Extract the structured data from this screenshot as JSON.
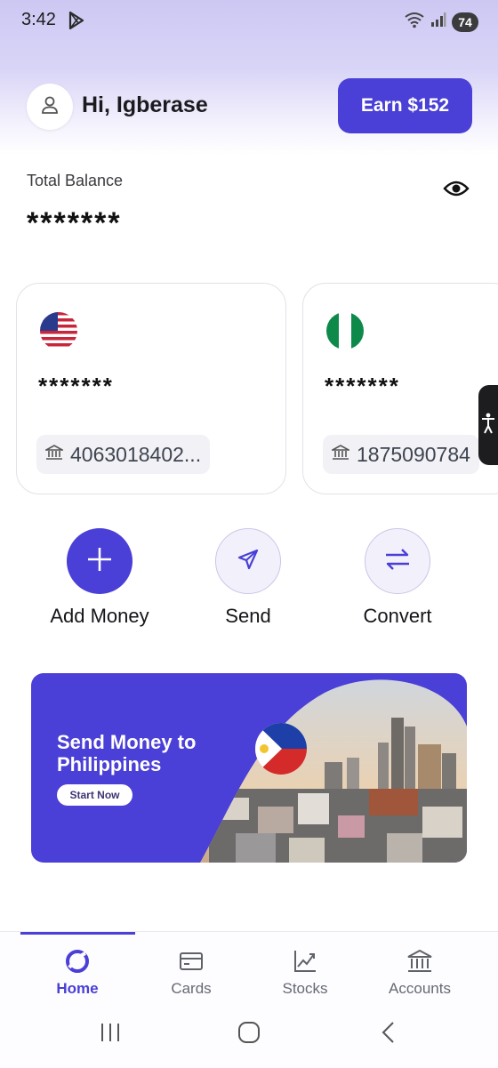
{
  "status_bar": {
    "time": "3:42",
    "battery": "74"
  },
  "header": {
    "greeting": "Hi, Igberase",
    "earn_label": "Earn $152"
  },
  "balance": {
    "label": "Total Balance",
    "value": "*******"
  },
  "wallets": [
    {
      "currency_flag": "us-flag",
      "balance": "*******",
      "account": "4063018402..."
    },
    {
      "currency_flag": "nigeria-flag",
      "balance": "*******",
      "account": "1875090784"
    }
  ],
  "actions": [
    {
      "label": "Add Money",
      "icon": "plus-icon"
    },
    {
      "label": "Send",
      "icon": "send-icon"
    },
    {
      "label": "Convert",
      "icon": "convert-icon"
    }
  ],
  "promo": {
    "title": "Send Money to Philippines",
    "cta": "Start Now"
  },
  "nav": {
    "items": [
      {
        "label": "Home",
        "icon": "home-icon",
        "active": true
      },
      {
        "label": "Cards",
        "icon": "cards-icon",
        "active": false
      },
      {
        "label": "Stocks",
        "icon": "stocks-icon",
        "active": false
      },
      {
        "label": "Accounts",
        "icon": "bank-icon",
        "active": false
      }
    ]
  },
  "colors": {
    "accent": "#4a3fd6",
    "header_tint": "#cdc8f3"
  }
}
